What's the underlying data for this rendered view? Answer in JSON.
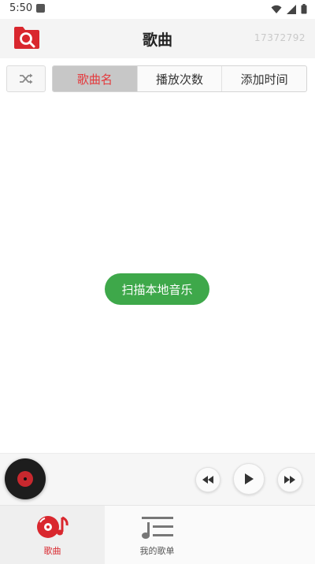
{
  "status_bar": {
    "time": "5:50",
    "icons": [
      "a-icon",
      "wifi-icon",
      "signal-icon",
      "battery-icon"
    ]
  },
  "header": {
    "title": "歌曲",
    "user_id": "17372792",
    "logo_icon": "folder-search-icon"
  },
  "toolbar": {
    "shuffle_icon": "shuffle-icon",
    "sort_tabs": [
      {
        "label": "歌曲名",
        "active": true
      },
      {
        "label": "播放次数",
        "active": false
      },
      {
        "label": "添加时间",
        "active": false
      }
    ]
  },
  "main": {
    "scan_button_label": "扫描本地音乐"
  },
  "player": {
    "prev_icon": "rewind-icon",
    "play_icon": "play-icon",
    "next_icon": "fast-forward-icon"
  },
  "bottom_nav": {
    "items": [
      {
        "label": "歌曲",
        "icon": "music-disc-icon",
        "active": true
      },
      {
        "label": "我的歌单",
        "icon": "playlist-icon",
        "active": false
      }
    ]
  },
  "colors": {
    "accent_red": "#e4393c",
    "scan_green": "#3ea84a",
    "header_bg": "#f4f4f4"
  }
}
